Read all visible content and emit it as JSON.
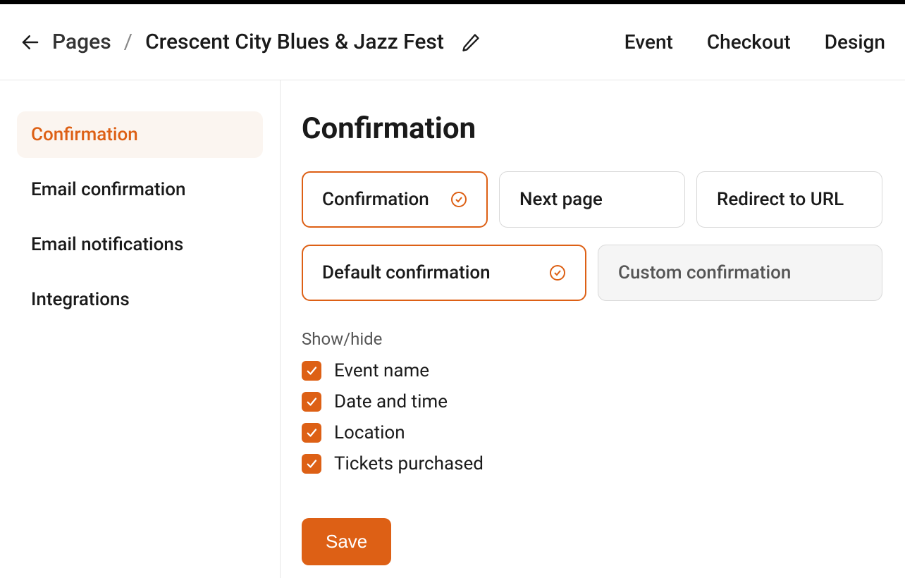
{
  "header": {
    "breadcrumb_root": "Pages",
    "breadcrumb_sep": "/",
    "breadcrumb_current": "Crescent City Blues & Jazz Fest",
    "nav": {
      "event": "Event",
      "checkout": "Checkout",
      "design": "Design"
    }
  },
  "sidebar": {
    "items": [
      {
        "label": "Confirmation",
        "active": true
      },
      {
        "label": "Email confirmation",
        "active": false
      },
      {
        "label": "Email notifications",
        "active": false
      },
      {
        "label": "Integrations",
        "active": false
      }
    ]
  },
  "main": {
    "title": "Confirmation",
    "type_options": [
      {
        "label": "Confirmation",
        "selected": true
      },
      {
        "label": "Next page",
        "selected": false
      },
      {
        "label": "Redirect to URL",
        "selected": false
      }
    ],
    "template_options": [
      {
        "label": "Default confirmation",
        "selected": true
      },
      {
        "label": "Custom confirmation",
        "selected": false
      }
    ],
    "show_hide_label": "Show/hide",
    "show_hide": [
      {
        "label": "Event name",
        "checked": true
      },
      {
        "label": "Date and time",
        "checked": true
      },
      {
        "label": "Location",
        "checked": true
      },
      {
        "label": "Tickets purchased",
        "checked": true
      }
    ],
    "save_label": "Save"
  }
}
